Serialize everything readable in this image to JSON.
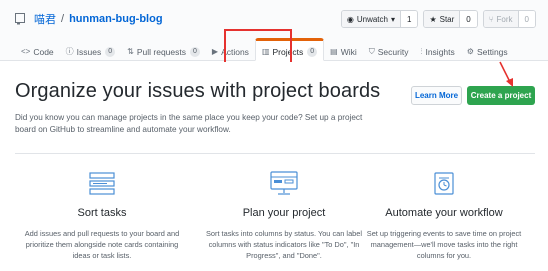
{
  "repo": {
    "owner": "喵君",
    "separator": "/",
    "name": "hunman-bug-blog"
  },
  "actions": [
    {
      "label": "Unwatch",
      "icon": "eye-icon",
      "caret": "▾",
      "count": "1",
      "disabled": false
    },
    {
      "label": "Star",
      "icon": "star-icon",
      "count": "0",
      "disabled": false
    },
    {
      "label": "Fork",
      "icon": "fork-icon",
      "count": "0",
      "disabled": true
    }
  ],
  "tabs": [
    {
      "label": "Code",
      "icon": "code-icon",
      "glyph": "<>"
    },
    {
      "label": "Issues",
      "icon": "issue-icon",
      "glyph": "ⓘ",
      "count": "0"
    },
    {
      "label": "Pull requests",
      "icon": "pull-request-icon",
      "glyph": "⇅",
      "count": "0"
    },
    {
      "label": "Actions",
      "icon": "actions-icon",
      "glyph": "▶"
    },
    {
      "label": "Projects",
      "icon": "project-icon",
      "glyph": "▥",
      "count": "0",
      "selected": true
    },
    {
      "label": "Wiki",
      "icon": "wiki-icon",
      "glyph": "▤"
    },
    {
      "label": "Security",
      "icon": "shield-icon",
      "glyph": "⛉"
    },
    {
      "label": "Insights",
      "icon": "graph-icon",
      "glyph": "⫶"
    },
    {
      "label": "Settings",
      "icon": "gear-icon",
      "glyph": "⚙"
    }
  ],
  "blankslate": {
    "headline": "Organize your issues with project boards",
    "lead": "Did you know you can manage projects in the same place you keep your code? Set up a project board on GitHub to streamline and automate your workflow.",
    "learn_more": "Learn More",
    "create_project": "Create a project"
  },
  "features": [
    {
      "title": "Sort tasks",
      "icon": "sort-tasks-icon",
      "text": "Add issues and pull requests to your board and prioritize them alongside note cards containing ideas or task lists."
    },
    {
      "title": "Plan your project",
      "icon": "plan-project-icon",
      "text": "Sort tasks into columns by status. You can label columns with status indicators like \"To Do\", \"In Progress\", and \"Done\"."
    },
    {
      "title": "Automate your workflow",
      "icon": "automate-workflow-icon",
      "text": "Set up triggering events to save time on project management—we'll move tasks into the right columns for you."
    }
  ],
  "colors": {
    "accent": "#0366d6",
    "primary_button": "#2ea44f",
    "selected_tab_border": "#e36209",
    "annotation": "#e5322f",
    "icon_stroke": "#4b8fd6"
  }
}
